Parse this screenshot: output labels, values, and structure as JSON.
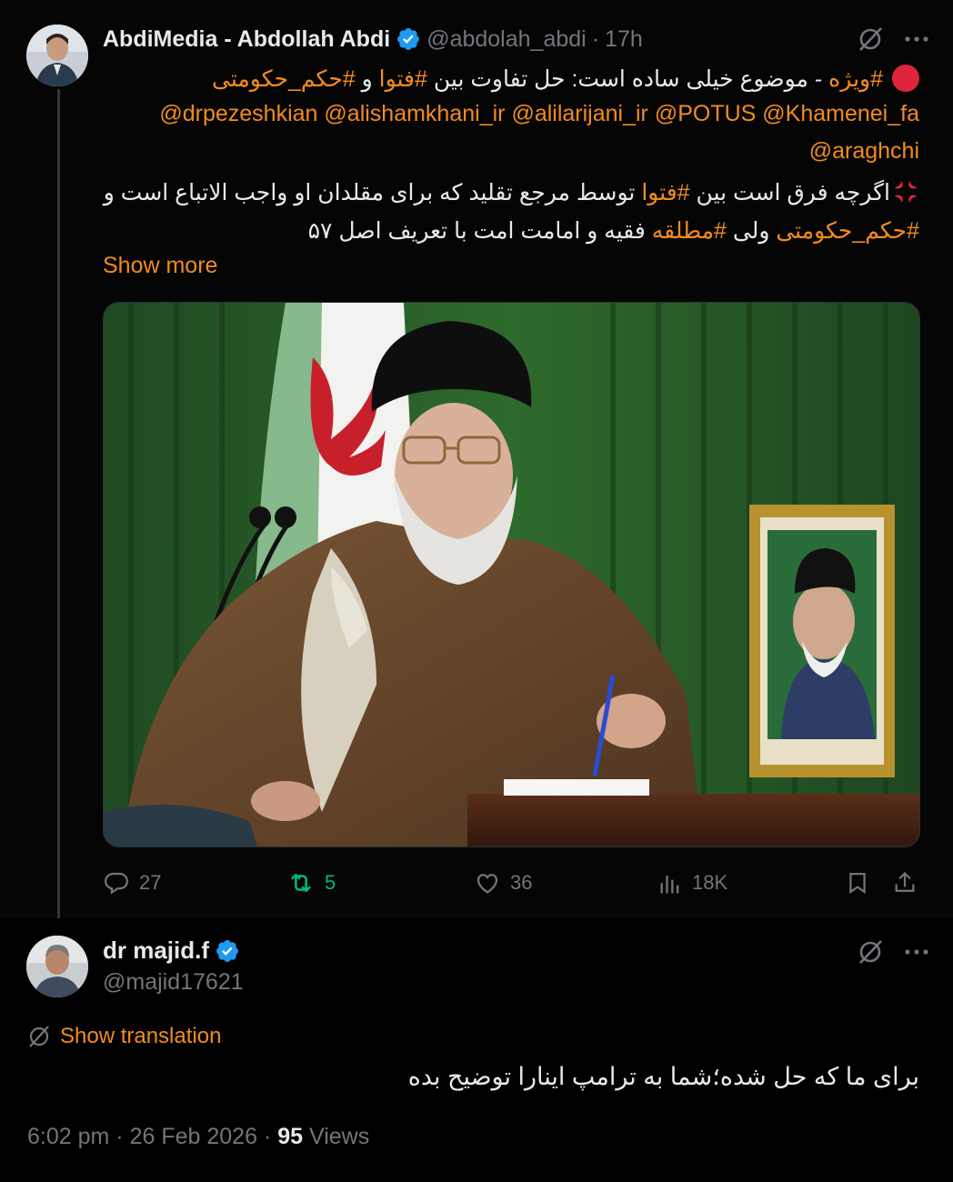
{
  "tweet": {
    "author_name": "AbdiMedia - Abdollah Abdi",
    "handle": "@abdolah_abdi",
    "separator": "·",
    "time": "17h",
    "line1_tag1": "#ویژه",
    "line1_text1": " - موضوع خیلی ساده است: حل تفاوت بین ",
    "line1_tag2": "#فتوا",
    "line1_text2": " و ",
    "line1_tag3": "#حکم_حکومتی",
    "mentions": [
      "@drpezeshkian",
      "@alishamkhani_ir",
      "@alilarijani_ir",
      "@POTUS",
      "@Khamenei_fa"
    ],
    "mention_last": "@araghchi",
    "para2_text1": "اگرچه فرق است بین ",
    "para2_tag1": "#فتوا",
    "para2_text2": " توسط مرجع تقلید که برای مقلدان او واجب الاتباع است و",
    "para3_tag1": "#حکم_حکومتی",
    "para3_text1": " ولی ",
    "para3_tag2": "#مطلقه",
    "para3_text2": " فقیه و امامت امت با تعریف اصل ۵۷",
    "show_more": "Show more",
    "replies": "27",
    "reposts": "5",
    "likes": "36",
    "views": "18K"
  },
  "reply": {
    "author_name": "dr majid.f",
    "handle": "@majid17621",
    "show_translation": "Show translation",
    "text": "برای ما که حل شده؛شما به ترامپ اینارا توضیح بده",
    "time": "6:02 pm",
    "separator": "·",
    "date": "26 Feb 2026",
    "views_count": "95",
    "views_label": "Views"
  },
  "colors": {
    "accent": "#f28b20",
    "verified": "#1d9bf0",
    "repost_active": "#00ba7c",
    "muted": "#71767b"
  },
  "icons": [
    "verified-badge-icon",
    "grok-icon",
    "more-icon",
    "red-circle-icon",
    "anger-icon",
    "reply-icon",
    "repost-icon",
    "like-icon",
    "views-icon",
    "bookmark-icon",
    "share-icon",
    "translate-icon"
  ]
}
